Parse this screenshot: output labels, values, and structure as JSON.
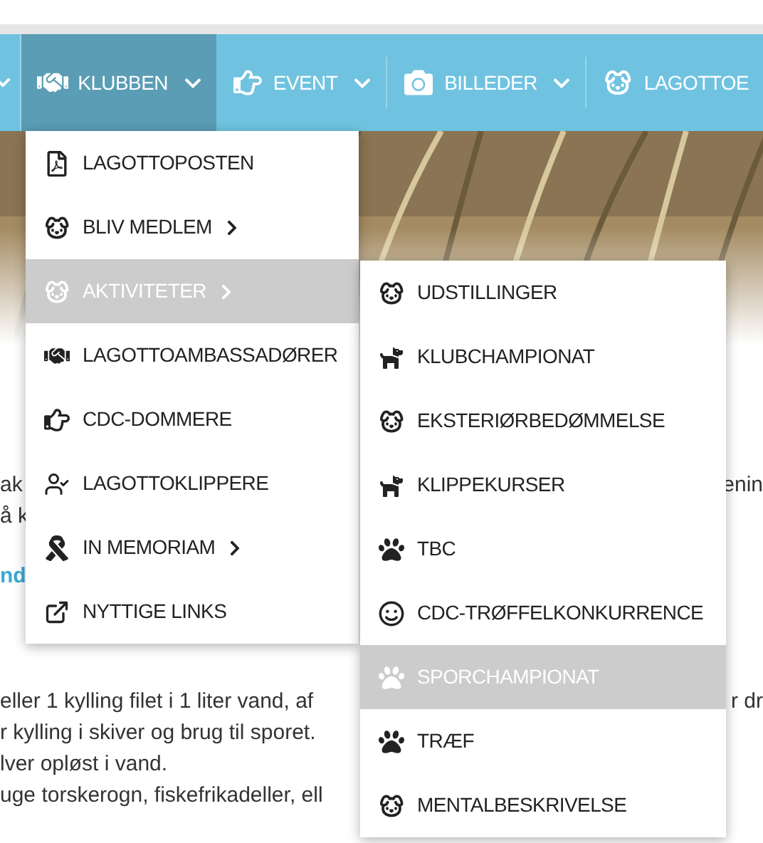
{
  "nav": {
    "items": [
      {
        "label": "KLUBBEN",
        "selected": true,
        "divider": false
      },
      {
        "label": "EVENT",
        "selected": false,
        "divider": false
      },
      {
        "label": "BILLEDER",
        "selected": false,
        "divider": true
      },
      {
        "label": "LAGOTTOE",
        "selected": false,
        "divider": true
      }
    ]
  },
  "menu": {
    "items": [
      {
        "label": "LAGOTTOPOSTEN",
        "selected": false,
        "submenu": false
      },
      {
        "label": "BLIV MEDLEM",
        "selected": false,
        "submenu": true
      },
      {
        "label": "AKTIVITETER",
        "selected": true,
        "submenu": true
      },
      {
        "label": "LAGOTTOAMBASSADØRER",
        "selected": false,
        "submenu": false
      },
      {
        "label": "CDC-DOMMERE",
        "selected": false,
        "submenu": false
      },
      {
        "label": "LAGOTTOKLIPPERE",
        "selected": false,
        "submenu": false
      },
      {
        "label": "IN MEMORIAM",
        "selected": false,
        "submenu": true
      },
      {
        "label": "NYTTIGE LINKS",
        "selected": false,
        "submenu": false
      }
    ]
  },
  "submenu": {
    "items": [
      {
        "label": "UDSTILLINGER",
        "selected": false
      },
      {
        "label": "KLUBCHAMPIONAT",
        "selected": false
      },
      {
        "label": "EKSTERIØRBEDØMMELSE",
        "selected": false
      },
      {
        "label": "KLIPPEKURSER",
        "selected": false
      },
      {
        "label": "TBC",
        "selected": false
      },
      {
        "label": "CDC-TRØFFELKONKURRENCE",
        "selected": false
      },
      {
        "label": "SPORCHAMPIONAT",
        "selected": true
      },
      {
        "label": "TRÆF",
        "selected": false
      },
      {
        "label": "MENTALBESKRIVELSE",
        "selected": false
      }
    ]
  },
  "content": {
    "rows": [
      {
        "left": "ak",
        "right": "enin",
        "kind": "text"
      },
      {
        "left": "å k",
        "kind": "text"
      },
      {
        "left": "nd",
        "kind": "link"
      },
      {
        "left": "eller 1 kylling filet i 1 liter vand, af",
        "right": "r dr",
        "kind": "text"
      },
      {
        "left": "r kylling i skiver og brug til sporet.",
        "kind": "text"
      },
      {
        "left": "lver opløst i vand.",
        "kind": "text"
      },
      {
        "left": "uge torskerogn, fiskefrikadeller, ell",
        "kind": "text"
      }
    ]
  }
}
